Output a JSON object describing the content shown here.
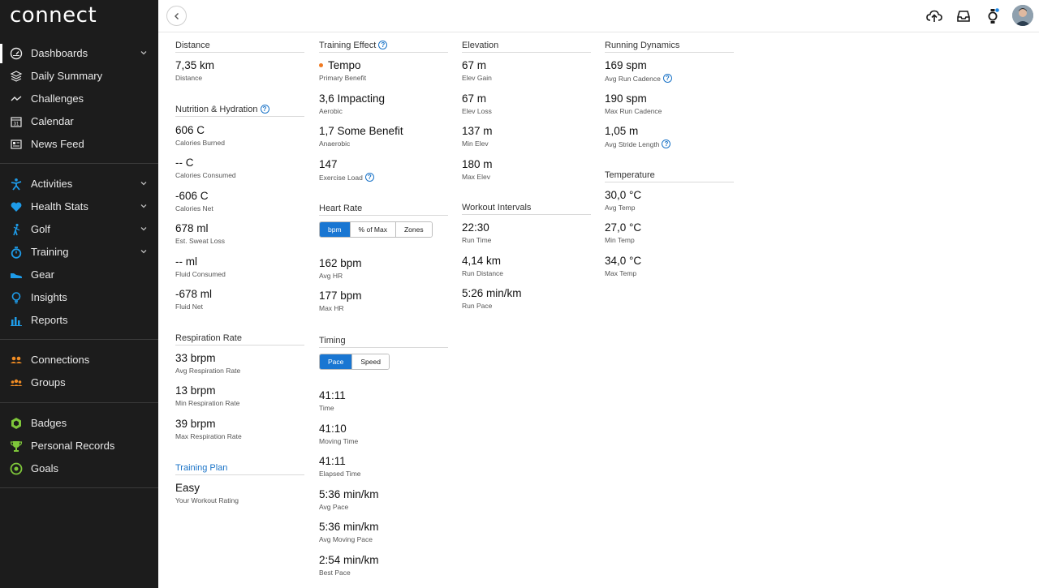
{
  "app": {
    "logo": "connect"
  },
  "sidebar": {
    "items": [
      {
        "label": "Dashboards",
        "icon": "dashboard-icon"
      },
      {
        "label": "Daily Summary",
        "icon": "layers-icon"
      },
      {
        "label": "Challenges",
        "icon": "challenges-icon"
      },
      {
        "label": "Calendar",
        "icon": "calendar-icon",
        "icon_text": "31"
      },
      {
        "label": "News Feed",
        "icon": "newsfeed-icon"
      },
      {
        "label": "Activities",
        "icon": "activity-icon"
      },
      {
        "label": "Health Stats",
        "icon": "heart-icon"
      },
      {
        "label": "Golf",
        "icon": "golf-icon"
      },
      {
        "label": "Training",
        "icon": "stopwatch-icon"
      },
      {
        "label": "Gear",
        "icon": "shoe-icon"
      },
      {
        "label": "Insights",
        "icon": "lightbulb-icon"
      },
      {
        "label": "Reports",
        "icon": "bar-chart-icon"
      },
      {
        "label": "Connections",
        "icon": "connections-icon"
      },
      {
        "label": "Groups",
        "icon": "groups-icon"
      },
      {
        "label": "Badges",
        "icon": "badge-icon"
      },
      {
        "label": "Personal Records",
        "icon": "trophy-icon"
      },
      {
        "label": "Goals",
        "icon": "target-icon"
      }
    ]
  },
  "colors": {
    "accent": "#1976d2",
    "help": "#1a73c7",
    "blue_icon": "#1e9be8",
    "orange_icon": "#f08c24",
    "green_icon": "#7ec63a",
    "tempo_dot": "#f07a22",
    "sidebar_bg": "#1c1c1c"
  },
  "col1": {
    "distance": {
      "title": "Distance",
      "value": "7,35 km",
      "label": "Distance"
    },
    "nutrition": {
      "title": "Nutrition & Hydration",
      "stats": [
        {
          "value": "606 C",
          "label": "Calories Burned"
        },
        {
          "value": "-- C",
          "label": "Calories Consumed"
        },
        {
          "value": "-606 C",
          "label": "Calories Net"
        },
        {
          "value": "678 ml",
          "label": "Est. Sweat Loss"
        },
        {
          "value": "-- ml",
          "label": "Fluid Consumed"
        },
        {
          "value": "-678 ml",
          "label": "Fluid Net"
        }
      ]
    },
    "respiration": {
      "title": "Respiration Rate",
      "stats": [
        {
          "value": "33 brpm",
          "label": "Avg Respiration Rate"
        },
        {
          "value": "13 brpm",
          "label": "Min Respiration Rate"
        },
        {
          "value": "39 brpm",
          "label": "Max Respiration Rate"
        }
      ]
    },
    "training_plan": {
      "title": "Training Plan",
      "value": "Easy",
      "label": "Your Workout Rating"
    }
  },
  "col2": {
    "training_effect": {
      "title": "Training Effect",
      "stats": [
        {
          "value": "Tempo",
          "label": "Primary Benefit"
        },
        {
          "value": "3,6 Impacting",
          "label": "Aerobic"
        },
        {
          "value": "1,7 Some Benefit",
          "label": "Anaerobic"
        },
        {
          "value": "147",
          "label": "Exercise Load"
        }
      ]
    },
    "heart_rate": {
      "title": "Heart Rate",
      "toggle": [
        "bpm",
        "% of Max",
        "Zones"
      ],
      "selected": "bpm",
      "stats": [
        {
          "value": "162 bpm",
          "label": "Avg HR"
        },
        {
          "value": "177 bpm",
          "label": "Max HR"
        }
      ]
    },
    "timing": {
      "title": "Timing",
      "toggle": [
        "Pace",
        "Speed"
      ],
      "selected": "Pace",
      "stats": [
        {
          "value": "41:11",
          "label": "Time"
        },
        {
          "value": "41:10",
          "label": "Moving Time"
        },
        {
          "value": "41:11",
          "label": "Elapsed Time"
        },
        {
          "value": "5:36 min/km",
          "label": "Avg Pace"
        },
        {
          "value": "5:36 min/km",
          "label": "Avg Moving Pace"
        },
        {
          "value": "2:54 min/km",
          "label": "Best Pace"
        }
      ]
    }
  },
  "col3": {
    "elevation": {
      "title": "Elevation",
      "stats": [
        {
          "value": "67 m",
          "label": "Elev Gain"
        },
        {
          "value": "67 m",
          "label": "Elev Loss"
        },
        {
          "value": "137 m",
          "label": "Min Elev"
        },
        {
          "value": "180 m",
          "label": "Max Elev"
        }
      ]
    },
    "intervals": {
      "title": "Workout Intervals",
      "stats": [
        {
          "value": "22:30",
          "label": "Run Time"
        },
        {
          "value": "4,14 km",
          "label": "Run Distance"
        },
        {
          "value": "5:26 min/km",
          "label": "Run Pace"
        }
      ]
    }
  },
  "col4": {
    "dynamics": {
      "title": "Running Dynamics",
      "stats": [
        {
          "value": "169 spm",
          "label": "Avg Run Cadence"
        },
        {
          "value": "190 spm",
          "label": "Max Run Cadence"
        },
        {
          "value": "1,05 m",
          "label": "Avg Stride Length"
        }
      ]
    },
    "temperature": {
      "title": "Temperature",
      "stats": [
        {
          "value": "30,0 °C",
          "label": "Avg Temp"
        },
        {
          "value": "27,0 °C",
          "label": "Min Temp"
        },
        {
          "value": "34,0 °C",
          "label": "Max Temp"
        }
      ]
    }
  },
  "topbar": {
    "icons": [
      "upload-icon",
      "inbox-icon",
      "device-icon",
      "avatar"
    ]
  }
}
